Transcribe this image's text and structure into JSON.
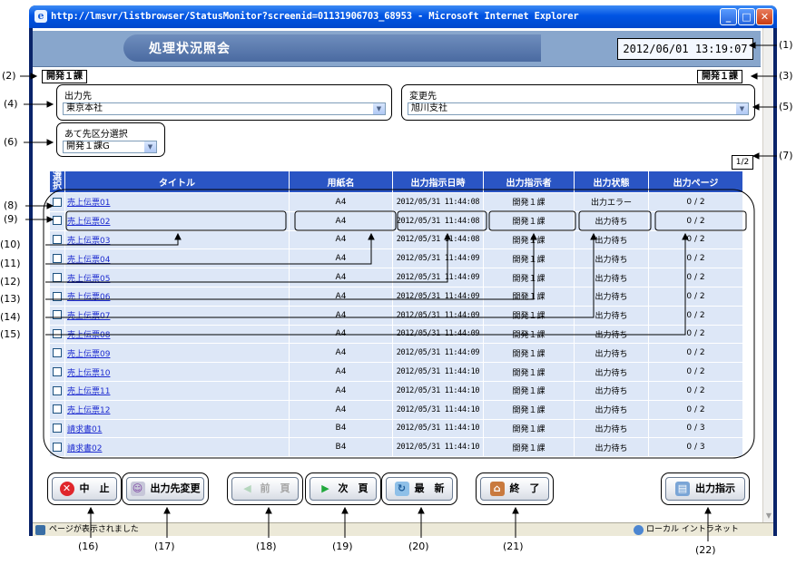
{
  "window": {
    "title": "http://lmsvr/listbrowser/StatusMonitor?screenid=01131906703_68953 - Microsoft Internet Explorer",
    "minimize_icon": "minimize-icon",
    "maximize_icon": "maximize-icon",
    "close_icon": "close-icon"
  },
  "header": {
    "title": "処理状況照会",
    "datetime": "2012/06/01 13:19:07"
  },
  "user_dept": "開発１課",
  "login_dept": "開発１課",
  "output_dest": {
    "label": "出力先",
    "value": "東京本社"
  },
  "change_dest": {
    "label": "変更先",
    "value": "旭川支社"
  },
  "dest_category": {
    "label": "あて先区分選択",
    "value": "開発１課G"
  },
  "page_indicator": "1/2",
  "table": {
    "headers": [
      "選択",
      "タイトル",
      "用紙名",
      "出力指示日時",
      "出力指示者",
      "出力状態",
      "出力ページ"
    ],
    "rows": [
      {
        "title": "売上伝票01",
        "paper": "A4",
        "datetime": "2012/05/31 11:44:08",
        "requester": "開発１課",
        "status": "出力エラー",
        "pages": "0 / 2"
      },
      {
        "title": "売上伝票02",
        "paper": "A4",
        "datetime": "2012/05/31 11:44:08",
        "requester": "開発１課",
        "status": "出力待ち",
        "pages": "0 / 2"
      },
      {
        "title": "売上伝票03",
        "paper": "A4",
        "datetime": "2012/05/31 11:44:08",
        "requester": "開発１課",
        "status": "出力待ち",
        "pages": "0 / 2"
      },
      {
        "title": "売上伝票04",
        "paper": "A4",
        "datetime": "2012/05/31 11:44:09",
        "requester": "開発１課",
        "status": "出力待ち",
        "pages": "0 / 2"
      },
      {
        "title": "売上伝票05",
        "paper": "A4",
        "datetime": "2012/05/31 11:44:09",
        "requester": "開発１課",
        "status": "出力待ち",
        "pages": "0 / 2"
      },
      {
        "title": "売上伝票06",
        "paper": "A4",
        "datetime": "2012/05/31 11:44:09",
        "requester": "開発１課",
        "status": "出力待ち",
        "pages": "0 / 2"
      },
      {
        "title": "売上伝票07",
        "paper": "A4",
        "datetime": "2012/05/31 11:44:09",
        "requester": "開発１課",
        "status": "出力待ち",
        "pages": "0 / 2"
      },
      {
        "title": "売上伝票08",
        "paper": "A4",
        "datetime": "2012/05/31 11:44:09",
        "requester": "開発１課",
        "status": "出力待ち",
        "pages": "0 / 2"
      },
      {
        "title": "売上伝票09",
        "paper": "A4",
        "datetime": "2012/05/31 11:44:09",
        "requester": "開発１課",
        "status": "出力待ち",
        "pages": "0 / 2"
      },
      {
        "title": "売上伝票10",
        "paper": "A4",
        "datetime": "2012/05/31 11:44:10",
        "requester": "開発１課",
        "status": "出力待ち",
        "pages": "0 / 2"
      },
      {
        "title": "売上伝票11",
        "paper": "A4",
        "datetime": "2012/05/31 11:44:10",
        "requester": "開発１課",
        "status": "出力待ち",
        "pages": "0 / 2"
      },
      {
        "title": "売上伝票12",
        "paper": "A4",
        "datetime": "2012/05/31 11:44:10",
        "requester": "開発１課",
        "status": "出力待ち",
        "pages": "0 / 2"
      },
      {
        "title": "請求書01",
        "paper": "B4",
        "datetime": "2012/05/31 11:44:10",
        "requester": "開発１課",
        "status": "出力待ち",
        "pages": "0 / 3"
      },
      {
        "title": "請求書02",
        "paper": "B4",
        "datetime": "2012/05/31 11:44:10",
        "requester": "開発１課",
        "status": "出力待ち",
        "pages": "0 / 3"
      }
    ]
  },
  "buttons": {
    "cancel": {
      "label": "中　止",
      "icon": "cancel-x-icon",
      "color": "#e0262b"
    },
    "change_dest": {
      "label": "出力先変更",
      "icon": "people-change-icon"
    },
    "prev": {
      "label": "前　頁",
      "icon": "arrow-left-icon",
      "enabled": false
    },
    "next": {
      "label": "次　頁",
      "icon": "arrow-right-icon",
      "color": "#21a83c"
    },
    "refresh": {
      "label": "最　新",
      "icon": "refresh-icon"
    },
    "exit": {
      "label": "終　了",
      "icon": "exit-door-icon"
    },
    "print": {
      "label": "出力指示",
      "icon": "print-icon"
    }
  },
  "statusbar": {
    "left": "ページが表示されました",
    "right": "ローカル イントラネット"
  },
  "callouts": [
    "(1)",
    "(2)",
    "(3)",
    "(4)",
    "(5)",
    "(6)",
    "(7)",
    "(8)",
    "(9)",
    "(10)",
    "(11)",
    "(12)",
    "(13)",
    "(14)",
    "(15)",
    "(16)",
    "(17)",
    "(18)",
    "(19)",
    "(20)",
    "(21)",
    "(22)"
  ],
  "colors": {
    "title_bar": "#0054e3",
    "page_header": "#88a6cc",
    "table_header": "#2a55c4",
    "table_row": "#dde7f7",
    "link": "#1d2bd0"
  }
}
